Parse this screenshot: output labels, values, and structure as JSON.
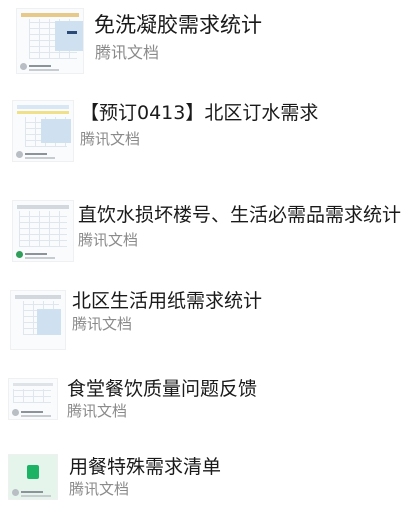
{
  "items": [
    {
      "title": "免洗凝胶需求统计",
      "source": "腾讯文档",
      "thumbnail": "spreadsheet-thumbnail"
    },
    {
      "title": "【预订0413】北区订水需求",
      "source": "腾讯文档",
      "thumbnail": "spreadsheet-thumbnail"
    },
    {
      "title": "直饮水损坏楼号、生活必需品需求统计",
      "source": "腾讯文档",
      "thumbnail": "spreadsheet-thumbnail"
    },
    {
      "title": "北区生活用纸需求统计",
      "source": "腾讯文档",
      "thumbnail": "spreadsheet-thumbnail"
    },
    {
      "title": "食堂餐饮质量问题反馈",
      "source": "腾讯文档",
      "thumbnail": "form-thumbnail"
    },
    {
      "title": "用餐特殊需求清单",
      "source": "腾讯文档",
      "thumbnail": "sheet-icon-thumbnail"
    }
  ],
  "colors": {
    "title": "#1a1a1a",
    "source": "#8a8a8a",
    "accent_green": "#1db364"
  }
}
